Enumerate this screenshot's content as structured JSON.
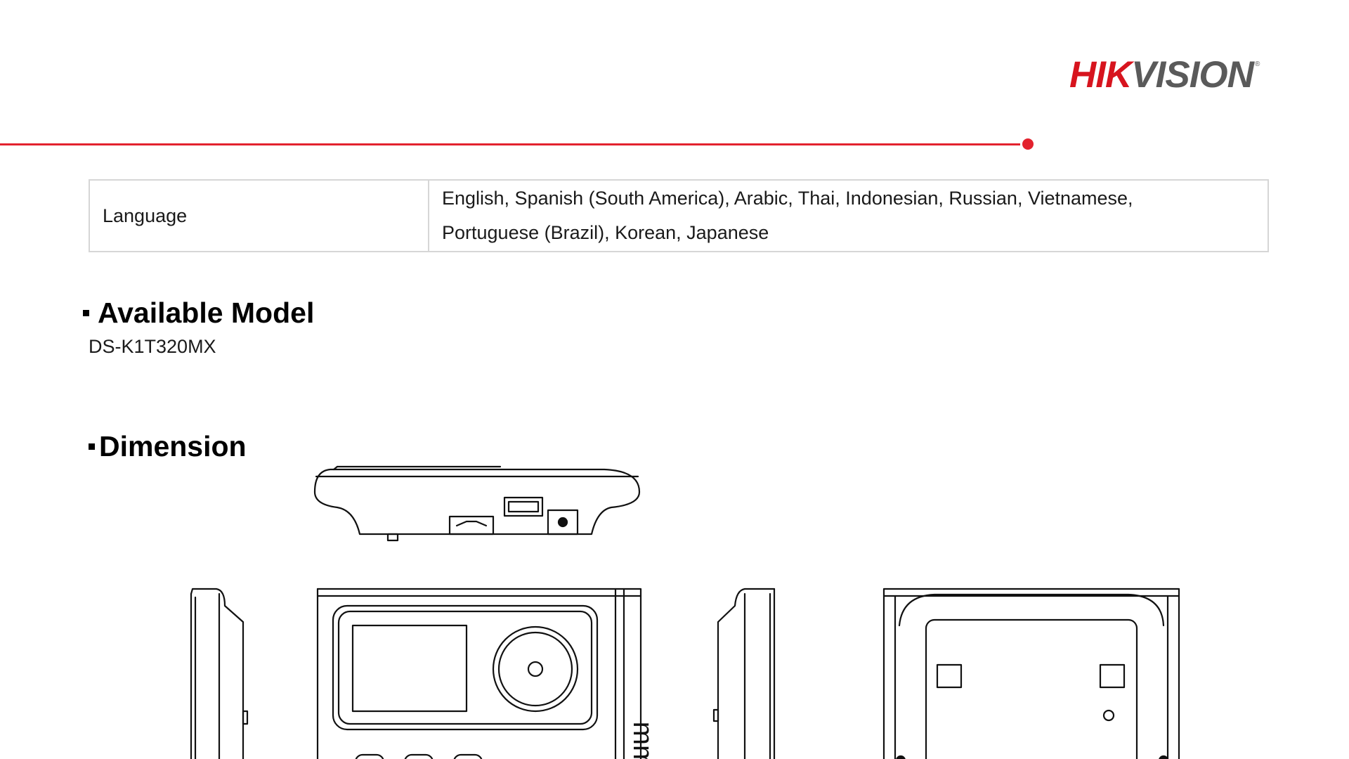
{
  "header": {
    "logo_hik": "HIK",
    "logo_vision": "VISION",
    "logo_mark": "®",
    "brand_color": "#e3222e"
  },
  "spec_table": {
    "rows": [
      {
        "key": "Language",
        "value_line1": "English, Spanish (South America), Arabic, Thai, Indonesian, Russian, Vietnamese,",
        "value_line2": "Portuguese (Brazil), Korean, Japanese"
      }
    ]
  },
  "sections": {
    "available_model": {
      "heading": "Available Model",
      "model": "DS-K1T320MX"
    },
    "dimension": {
      "heading": "Dimension",
      "unit_label": "mm"
    }
  }
}
